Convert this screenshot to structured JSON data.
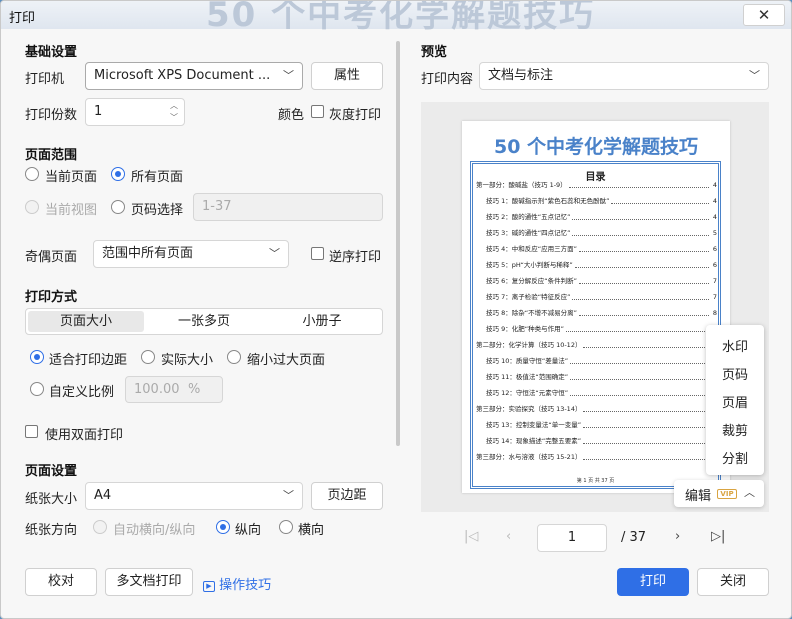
{
  "window": {
    "title": "打印",
    "bg_title": "50 个中考化学解题技巧",
    "close": "✕"
  },
  "basic": {
    "heading": "基础设置",
    "printer_label": "打印机",
    "printer_value": "Microsoft XPS Document ...",
    "properties_button": "属性",
    "copies_label": "打印份数",
    "copies_value": "1",
    "color_label": "颜色",
    "grayscale_label": "灰度打印"
  },
  "range": {
    "heading": "页面范围",
    "current_page": "当前页面",
    "all_pages": "所有页面",
    "current_view": "当前视图",
    "page_select": "页码选择",
    "page_select_placeholder": "1-37",
    "odd_even_label": "奇偶页面",
    "odd_even_value": "范围中所有页面",
    "reverse_label": "逆序打印"
  },
  "mode": {
    "heading": "打印方式",
    "tabs": [
      "页面大小",
      "一张多页",
      "小册子"
    ],
    "fit_margins": "适合打印边距",
    "actual_size": "实际大小",
    "shrink_large": "缩小过大页面",
    "custom_scale": "自定义比例",
    "scale_value": "100.00",
    "scale_unit": "%",
    "duplex": "使用双面打印"
  },
  "page_setup": {
    "heading": "页面设置",
    "paper_size_label": "纸张大小",
    "paper_size_value": "A4",
    "margins_button": "页边距",
    "orientation_label": "纸张方向",
    "auto_orientation": "自动横向/纵向",
    "portrait": "纵向",
    "landscape": "横向"
  },
  "footer": {
    "proofread": "校对",
    "multi_doc": "多文档打印",
    "tips": "操作技巧",
    "print": "打印",
    "close": "关闭"
  },
  "preview": {
    "heading": "预览",
    "content_label": "打印内容",
    "content_value": "文档与标注",
    "doc_title": "50 个中考化学解题技巧",
    "toc_heading": "目录",
    "toc": [
      {
        "text": "第一部分：酸碱盐（技巧 1-9）",
        "page": "4",
        "indent": false
      },
      {
        "text": "技巧 1：酸碱指示剂“紫色石蕊和无色酚酞”",
        "page": "4",
        "indent": true
      },
      {
        "text": "技巧 2：酸的通性“五点记忆”",
        "page": "4",
        "indent": true
      },
      {
        "text": "技巧 3：碱的通性“四点记忆”",
        "page": "5",
        "indent": true
      },
      {
        "text": "技巧 4：中和反应“应用三方面”",
        "page": "6",
        "indent": true
      },
      {
        "text": "技巧 5：pH“大小判断与稀释”",
        "page": "6",
        "indent": true
      },
      {
        "text": "技巧 6：复分解反应“条件判断”",
        "page": "7",
        "indent": true
      },
      {
        "text": "技巧 7：离子检验“特征反应”",
        "page": "7",
        "indent": true
      },
      {
        "text": "技巧 8：除杂“不增不减易分离”",
        "page": "8",
        "indent": true
      },
      {
        "text": "技巧 9：化肥“种类与作用”",
        "page": "",
        "indent": true
      },
      {
        "text": "第二部分：化学计算（技巧 10-12）",
        "page": "",
        "indent": false
      },
      {
        "text": "技巧 10：质量守恒“差量法”",
        "page": "",
        "indent": true
      },
      {
        "text": "技巧 11：极值法“范围确定”",
        "page": "",
        "indent": true
      },
      {
        "text": "技巧 12：守恒法“元素守恒”",
        "page": "",
        "indent": true
      },
      {
        "text": "第三部分：实验探究（技巧 13-14）",
        "page": "",
        "indent": false
      },
      {
        "text": "技巧 13：控制变量法“单一变量”",
        "page": "",
        "indent": true
      },
      {
        "text": "技巧 14：现象描述“完整五要素”",
        "page": "",
        "indent": true
      },
      {
        "text": "第三部分：水与溶液（技巧 15-21）",
        "page": "",
        "indent": false
      }
    ],
    "page_footer": "第 1 页 共 37 页",
    "menu_items": [
      "水印",
      "页码",
      "页眉",
      "裁剪",
      "分割"
    ],
    "edit_label": "编辑",
    "vip_badge": "VIP",
    "current_page": "1",
    "total_pages": "/ 37"
  },
  "colors": {
    "accent": "#2f6fe6",
    "doc_blue": "#4a82c9"
  }
}
